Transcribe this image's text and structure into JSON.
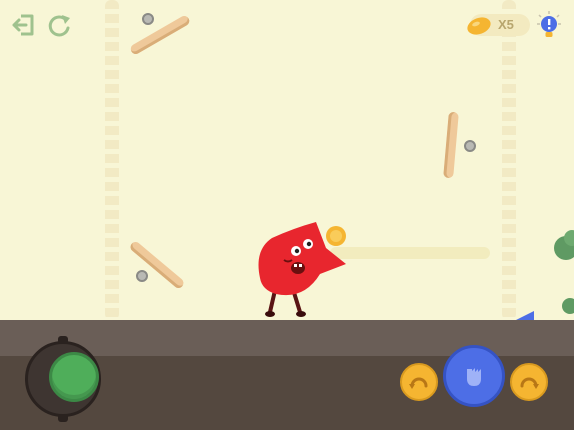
{
  "hud": {
    "exit_icon": "exit-door-icon",
    "restart_icon": "restart-arrow-icon",
    "coin_icon": "bean-coin-icon",
    "coin_count": "X5",
    "hint_icon": "lightbulb-hint-icon"
  },
  "controls": {
    "joystick": "move-joystick",
    "rotate_left_icon": "rotate-left-icon",
    "grab_icon": "grab-hand-icon",
    "rotate_right_icon": "rotate-right-icon"
  },
  "colors": {
    "background": "#f8f6d6",
    "character": "#e8262e",
    "joystick": "#4fae5a",
    "action_button": "#4d6ee6",
    "rotate_button": "#f5b531",
    "floor": "#6a5e57"
  }
}
